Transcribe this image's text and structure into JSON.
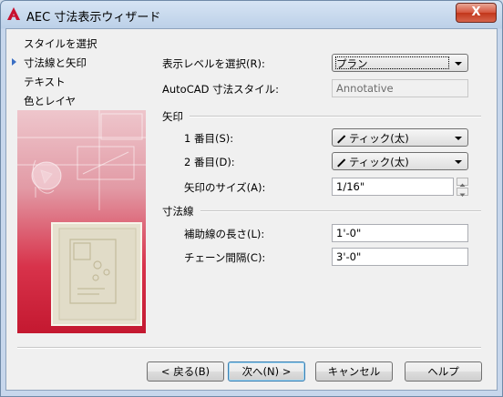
{
  "window": {
    "title": "AEC 寸法表示ウィザード",
    "close_label": "X"
  },
  "nav": {
    "items": [
      {
        "label": "スタイルを選択"
      },
      {
        "label": "寸法線と矢印"
      },
      {
        "label": "テキスト"
      },
      {
        "label": "色とレイヤ"
      }
    ]
  },
  "form": {
    "display_level_label": "表示レベルを選択(R):",
    "display_level_value": "プラン",
    "autocad_style_label": "AutoCAD 寸法スタイル:",
    "autocad_style_value": "Annotative",
    "arrow_section": "矢印",
    "first_label": "1 番目(S):",
    "first_value": "ティック(太)",
    "second_label": "2 番目(D):",
    "second_value": "ティック(太)",
    "arrow_size_label": "矢印のサイズ(A):",
    "arrow_size_value": "1/16\"",
    "dim_section": "寸法線",
    "ext_len_label": "補助線の長さ(L):",
    "ext_len_value": "1'-0\"",
    "chain_gap_label": "チェーン間隔(C):",
    "chain_gap_value": "3'-0\""
  },
  "buttons": {
    "back": "< 戻る(B)",
    "next": "次へ(N) >",
    "cancel": "キャンセル",
    "help": "ヘルプ"
  },
  "colors": {
    "accent": "#d8243a",
    "nav_arrow": "#3b6fc4"
  }
}
